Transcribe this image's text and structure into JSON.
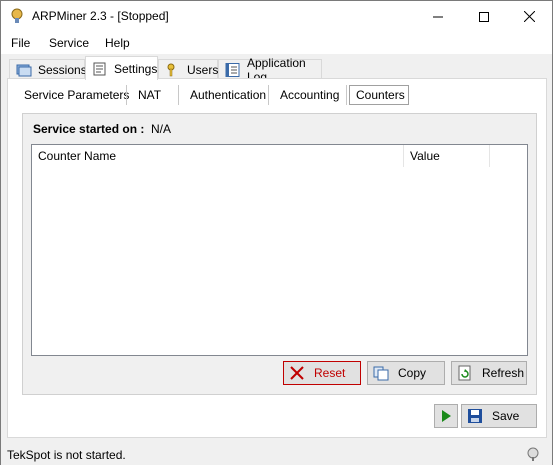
{
  "window": {
    "title": "ARPMiner 2.3 - [Stopped]"
  },
  "menu": [
    "File",
    "Service",
    "Help"
  ],
  "tabs": [
    {
      "label": "Sessions",
      "icon": "sessions-icon"
    },
    {
      "label": "Settings",
      "icon": "settings-icon",
      "active": true
    },
    {
      "label": "Users",
      "icon": "key-icon"
    },
    {
      "label": "Application Log",
      "icon": "log-icon"
    }
  ],
  "subtabs": [
    "Service Parameters",
    "NAT",
    "Authentication",
    "Accounting",
    "Counters"
  ],
  "counters": {
    "service_started_label": "Service started on :",
    "service_started_value": "N/A",
    "columns": [
      "Counter Name",
      "Value"
    ],
    "rows": []
  },
  "buttons": {
    "reset": "Reset",
    "copy": "Copy",
    "refresh": "Refresh",
    "save": "Save"
  },
  "status": {
    "text": "TekSpot is not started."
  },
  "colors": {
    "reset_border": "#c00000",
    "reset_icon": "#c00000",
    "play_icon": "#1a8a1a",
    "save_icon": "#1f4e9c"
  }
}
